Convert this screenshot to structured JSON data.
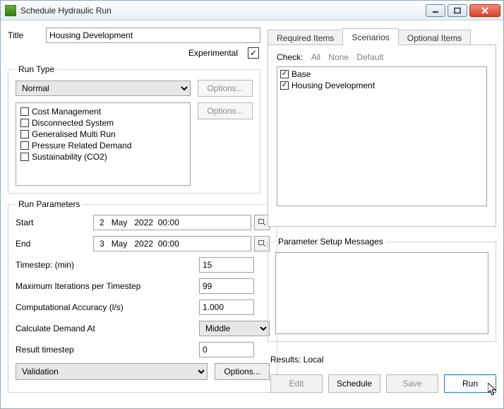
{
  "window": {
    "title": "Schedule Hydraulic Run"
  },
  "title_field": {
    "label": "Title",
    "value": "Housing Development"
  },
  "experimental_label": "Experimental",
  "experimental_checked": true,
  "run_type": {
    "legend": "Run Type",
    "selected": "Normal",
    "options_btn1": "Options...",
    "options_btn2": "Options...",
    "features": [
      "Cost Management",
      "Disconnected System",
      "Generalised Multi Run",
      "Pressure Related Demand",
      "Sustainability (CO2)"
    ]
  },
  "run_params": {
    "legend": "Run Parameters",
    "start_label": "Start",
    "start_value": {
      "day": "2",
      "month": "May",
      "year": "2022",
      "time": "00:00"
    },
    "end_label": "End",
    "end_value": {
      "day": "3",
      "month": "May",
      "year": "2022",
      "time": "00:00"
    },
    "timestep_label": "Timestep: (min)",
    "timestep_value": "15",
    "maxiter_label": "Maximum Iterations per Timestep",
    "maxiter_value": "99",
    "accuracy_label": "Computational Accuracy (l/s)",
    "accuracy_value": "1.000",
    "calcdemand_label": "Calculate Demand At",
    "calcdemand_value": "Middle",
    "result_ts_label": "Result timestep",
    "result_ts_value": "0",
    "validation_value": "Validation",
    "validation_options_btn": "Options..."
  },
  "tabs": {
    "required": "Required Items",
    "scenarios": "Scenarios",
    "optional": "Optional Items"
  },
  "check_row": {
    "label": "Check:",
    "all": "All",
    "none": "None",
    "default": "Default"
  },
  "scenarios_list": [
    "Base",
    "Housing Development"
  ],
  "psm_legend": "Parameter Setup Messages",
  "results_label": "Results: Local",
  "buttons": {
    "edit": "Edit",
    "schedule": "Schedule",
    "save": "Save",
    "run": "Run"
  }
}
